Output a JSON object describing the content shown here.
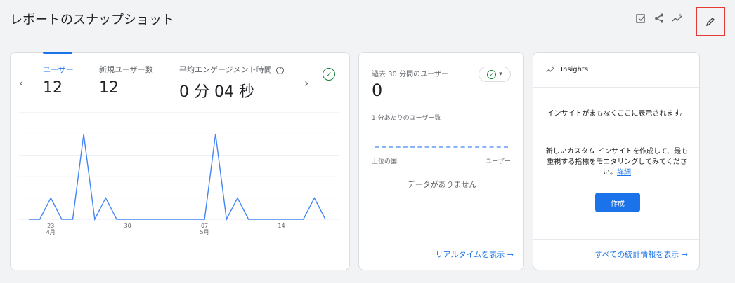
{
  "page": {
    "title": "レポートのスナップショット"
  },
  "toolbar": {
    "icons": [
      "edit-report-icon",
      "share-icon",
      "insights-icon",
      "pencil-icon"
    ]
  },
  "main": {
    "prev": "‹",
    "next": "›",
    "metrics": [
      {
        "label": "ユーザー",
        "value": "12"
      },
      {
        "label": "新規ユーザー数",
        "value": "12"
      },
      {
        "label": "平均エンゲージメント時間",
        "value": "0 分 04 秒"
      }
    ],
    "help": "?"
  },
  "chart_data": {
    "type": "line",
    "series": [
      {
        "values": [
          0,
          0,
          1,
          0,
          0,
          4,
          0,
          1,
          0,
          0,
          0,
          0,
          0,
          0,
          0,
          0,
          0,
          4,
          0,
          1,
          0,
          0,
          0,
          0,
          0,
          0,
          1,
          0
        ]
      }
    ],
    "x_ticks": [
      {
        "index": 2,
        "day": "23",
        "month": "4月"
      },
      {
        "index": 9,
        "day": "30",
        "month": ""
      },
      {
        "index": 16,
        "day": "07",
        "month": "5月"
      },
      {
        "index": 23,
        "day": "14",
        "month": ""
      }
    ],
    "y_ticks": [
      "5",
      "4",
      "3",
      "2",
      "1",
      "0"
    ],
    "ylim": [
      0,
      5
    ],
    "line_color": "#4285f4",
    "grid": true
  },
  "realtime": {
    "title": "過去 30 分間のユーザー",
    "value": "0",
    "per_min": "1 分あたりのユーザー数",
    "col_country": "上位の国",
    "col_users": "ユーザー",
    "no_data": "データがありません",
    "link": "リアルタイムを表示 →"
  },
  "insights": {
    "title": "Insights",
    "text1": "インサイトがまもなくここに表示されます。",
    "text2": "新しいカスタム インサイトを作成して、最も重視する指標をモニタリングしてみてください。",
    "detail_link": "詳細",
    "create_button": "作成",
    "link": "すべての統計情報を表示 →"
  },
  "colors": {
    "accent": "#1a73e8",
    "success": "#188038",
    "highlight": "#e53935"
  }
}
